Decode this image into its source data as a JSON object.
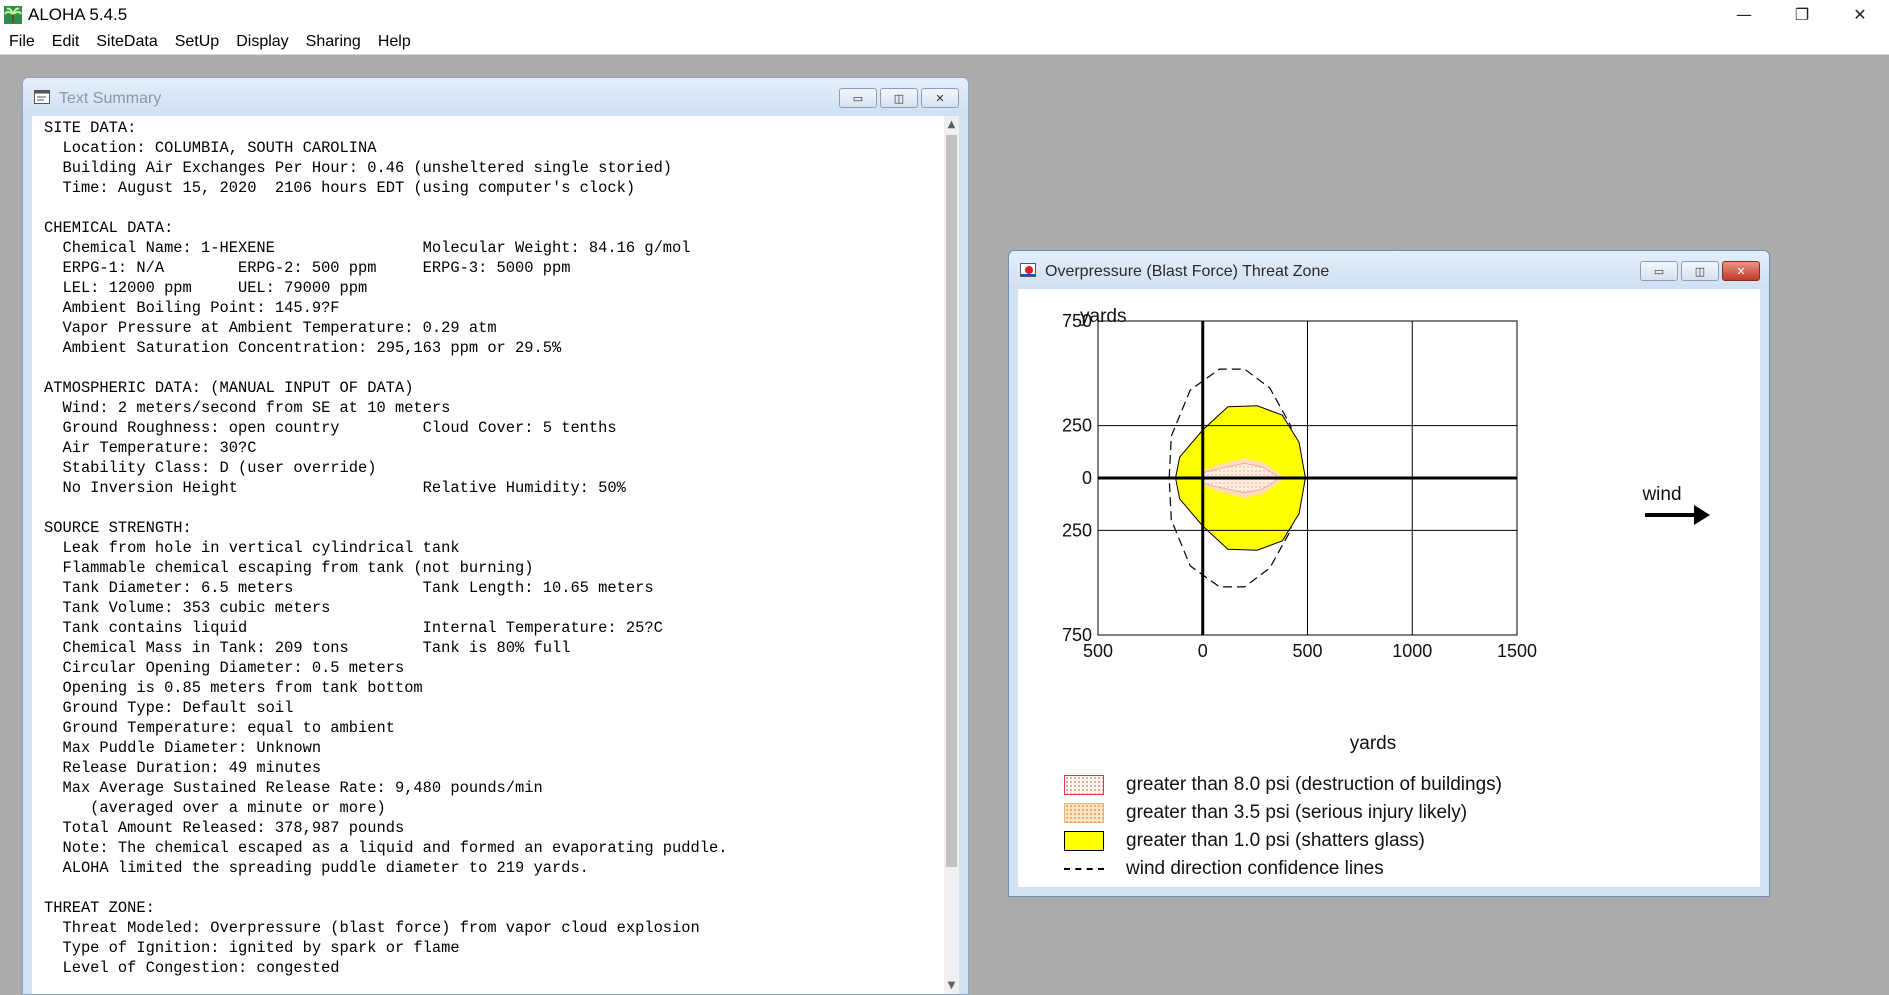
{
  "app": {
    "title": "ALOHA 5.4.5",
    "window_controls": [
      "—",
      "❐",
      "✕"
    ]
  },
  "menu": [
    "File",
    "Edit",
    "SiteData",
    "SetUp",
    "Display",
    "Sharing",
    "Help"
  ],
  "text_summary": {
    "title": "Text Summary",
    "lines": [
      "SITE DATA:",
      "  Location: COLUMBIA, SOUTH CAROLINA",
      "  Building Air Exchanges Per Hour: 0.46 (unsheltered single storied)",
      "  Time: August 15, 2020  2106 hours EDT (using computer's clock)",
      "",
      "CHEMICAL DATA:",
      "  Chemical Name: 1-HEXENE                Molecular Weight: 84.16 g/mol",
      "  ERPG-1: N/A        ERPG-2: 500 ppm     ERPG-3: 5000 ppm",
      "  LEL: 12000 ppm     UEL: 79000 ppm",
      "  Ambient Boiling Point: 145.9?F",
      "  Vapor Pressure at Ambient Temperature: 0.29 atm",
      "  Ambient Saturation Concentration: 295,163 ppm or 29.5%",
      "",
      "ATMOSPHERIC DATA: (MANUAL INPUT OF DATA)",
      "  Wind: 2 meters/second from SE at 10 meters",
      "  Ground Roughness: open country         Cloud Cover: 5 tenths",
      "  Air Temperature: 30?C",
      "  Stability Class: D (user override)",
      "  No Inversion Height                    Relative Humidity: 50%",
      "",
      "SOURCE STRENGTH:",
      "  Leak from hole in vertical cylindrical tank",
      "  Flammable chemical escaping from tank (not burning)",
      "  Tank Diameter: 6.5 meters              Tank Length: 10.65 meters",
      "  Tank Volume: 353 cubic meters",
      "  Tank contains liquid                   Internal Temperature: 25?C",
      "  Chemical Mass in Tank: 209 tons        Tank is 80% full",
      "  Circular Opening Diameter: 0.5 meters",
      "  Opening is 0.85 meters from tank bottom",
      "  Ground Type: Default soil",
      "  Ground Temperature: equal to ambient",
      "  Max Puddle Diameter: Unknown",
      "  Release Duration: 49 minutes",
      "  Max Average Sustained Release Rate: 9,480 pounds/min",
      "     (averaged over a minute or more)",
      "  Total Amount Released: 378,987 pounds",
      "  Note: The chemical escaped as a liquid and formed an evaporating puddle.",
      "  ALOHA limited the spreading puddle diameter to 219 yards.",
      "",
      "THREAT ZONE:",
      "  Threat Modeled: Overpressure (blast force) from vapor cloud explosion",
      "  Type of Ignition: ignited by spark or flame",
      "  Level of Congestion: congested"
    ]
  },
  "threat_zone": {
    "title": "Overpressure (Blast Force) Threat Zone",
    "wind_label": "wind",
    "legend": [
      {
        "swatch": "sw-8",
        "label": "greater than 8.0 psi (destruction of buildings)"
      },
      {
        "swatch": "sw-35",
        "label": "greater than 3.5 psi (serious injury likely)"
      },
      {
        "swatch": "sw-10",
        "label": "greater than 1.0 psi (shatters glass)"
      },
      {
        "swatch": "sw-wind",
        "label": "wind direction confidence lines"
      }
    ],
    "colors": {
      "zone_1psi": "#ffff00",
      "zone_3_5psi": "#ffddb8",
      "zone_8psi": "#ffeede",
      "grid": "#000000"
    },
    "chart_data": {
      "type": "map",
      "x_axis_label": "yards",
      "y_axis_label": "yards",
      "xlim": [
        -500,
        1500
      ],
      "ylim": [
        -750,
        750
      ],
      "x_ticks": [
        -500,
        0,
        500,
        1000,
        1500
      ],
      "x_tick_labels": [
        "500",
        "0",
        "500",
        "1000",
        "1500"
      ],
      "y_ticks": [
        750,
        250,
        0,
        -250,
        -750
      ],
      "y_tick_labels": [
        "750",
        "250",
        "0",
        "250",
        "750"
      ],
      "zones": [
        {
          "name": "wind direction confidence lines",
          "points": [
            [
              -160,
              0
            ],
            [
              -150,
              200
            ],
            [
              -60,
              420
            ],
            [
              80,
              520
            ],
            [
              200,
              520
            ],
            [
              320,
              430
            ],
            [
              420,
              250
            ],
            [
              450,
              0
            ],
            [
              420,
              -250
            ],
            [
              320,
              -430
            ],
            [
              200,
              -520
            ],
            [
              80,
              -520
            ],
            [
              -60,
              -420
            ],
            [
              -150,
              -200
            ]
          ]
        },
        {
          "name": "greater than 1.0 psi",
          "points": [
            [
              -130,
              0
            ],
            [
              -110,
              100
            ],
            [
              0,
              230
            ],
            [
              120,
              340
            ],
            [
              260,
              345
            ],
            [
              380,
              300
            ],
            [
              460,
              170
            ],
            [
              490,
              0
            ],
            [
              460,
              -170
            ],
            [
              380,
              -300
            ],
            [
              260,
              -345
            ],
            [
              120,
              -340
            ],
            [
              0,
              -230
            ],
            [
              -110,
              -100
            ]
          ]
        },
        {
          "name": "greater than 3.5 psi",
          "points": [
            [
              0,
              35
            ],
            [
              80,
              65
            ],
            [
              200,
              95
            ],
            [
              290,
              75
            ],
            [
              360,
              25
            ],
            [
              390,
              0
            ],
            [
              360,
              -25
            ],
            [
              290,
              -75
            ],
            [
              200,
              -95
            ],
            [
              80,
              -65
            ],
            [
              0,
              -35
            ]
          ]
        },
        {
          "name": "greater than 8.0 psi",
          "points": [
            [
              0,
              25
            ],
            [
              80,
              45
            ],
            [
              200,
              70
            ],
            [
              280,
              55
            ],
            [
              340,
              20
            ],
            [
              360,
              0
            ],
            [
              340,
              -20
            ],
            [
              280,
              -55
            ],
            [
              200,
              -70
            ],
            [
              80,
              -45
            ],
            [
              0,
              -25
            ]
          ]
        }
      ]
    }
  }
}
